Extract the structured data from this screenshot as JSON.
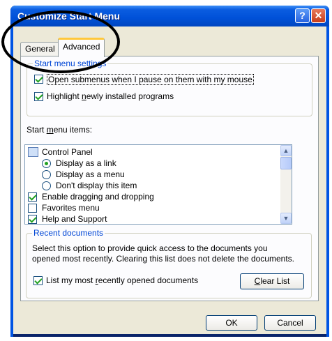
{
  "window": {
    "title": "Customize Start Menu",
    "help_glyph": "?",
    "close_glyph": "✕"
  },
  "tabs": [
    {
      "label": "General",
      "selected": false
    },
    {
      "label": "Advanced",
      "selected": true
    }
  ],
  "settings_group": {
    "legend": "Start menu settings",
    "option1": {
      "label": "Open submenus when I pause on them with my mouse",
      "checked": true
    },
    "option2": {
      "label_pre": "Highlight ",
      "label_u": "n",
      "label_post": "ewly installed programs",
      "checked": true
    }
  },
  "items_list": {
    "label_pre": "Start ",
    "label_u": "m",
    "label_post": "enu items:",
    "items": [
      {
        "label": "Control Panel",
        "kind": "header",
        "icon": "control-panel-icon"
      },
      {
        "label": "Display as a link",
        "kind": "radio",
        "checked": true
      },
      {
        "label": "Display as a menu",
        "kind": "radio",
        "checked": false
      },
      {
        "label": "Don't display this item",
        "kind": "radio",
        "checked": false
      },
      {
        "label": "Enable dragging and dropping",
        "kind": "check",
        "checked": true
      },
      {
        "label": "Favorites menu",
        "kind": "check",
        "checked": false
      },
      {
        "label": "Help and Support",
        "kind": "check",
        "checked": true
      }
    ],
    "scroll_up_glyph": "▲",
    "scroll_down_glyph": "▼"
  },
  "recent_group": {
    "legend": "Recent documents",
    "description_line1": "Select this option to provide quick access to the documents you",
    "description_line2": "opened most recently.  Clearing this list does not delete the documents.",
    "list_option": {
      "label_pre": "List my most ",
      "label_u": "r",
      "label_post": "ecently opened documents",
      "checked": true
    },
    "clear_button": {
      "label_u": "C",
      "label_post": "lear List"
    }
  },
  "footer": {
    "ok_label": "OK",
    "cancel_label": "Cancel"
  },
  "colors": {
    "title_bar": "#0054e3",
    "accent_tab": "#ffc83c",
    "legend_text": "#0046d5",
    "check_mark": "#21a121"
  }
}
